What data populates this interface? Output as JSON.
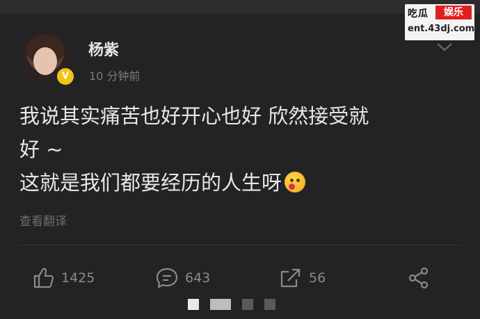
{
  "watermark": {
    "brand": "吃瓜",
    "tag": "娱乐",
    "url": "ent.43dj.com"
  },
  "post": {
    "author": "杨紫",
    "verified_badge": "V",
    "timestamp": "10 分钟前",
    "text_lines": [
      "我说其实痛苦也好开心也好 欣然接受就",
      "好 ~",
      "这就是我们都要经历的人生呀"
    ],
    "emoji": "smiling-face-tongue-emoji",
    "translate_label": "查看翻译"
  },
  "actions": {
    "like_count": "1425",
    "comment_count": "643",
    "repost_count": "56"
  },
  "icons": {
    "like": "thumbs-up-icon",
    "comment": "comment-bubble-icon",
    "repost": "repost-arrow-icon",
    "share": "share-icon",
    "more": "chevron-down-icon"
  }
}
